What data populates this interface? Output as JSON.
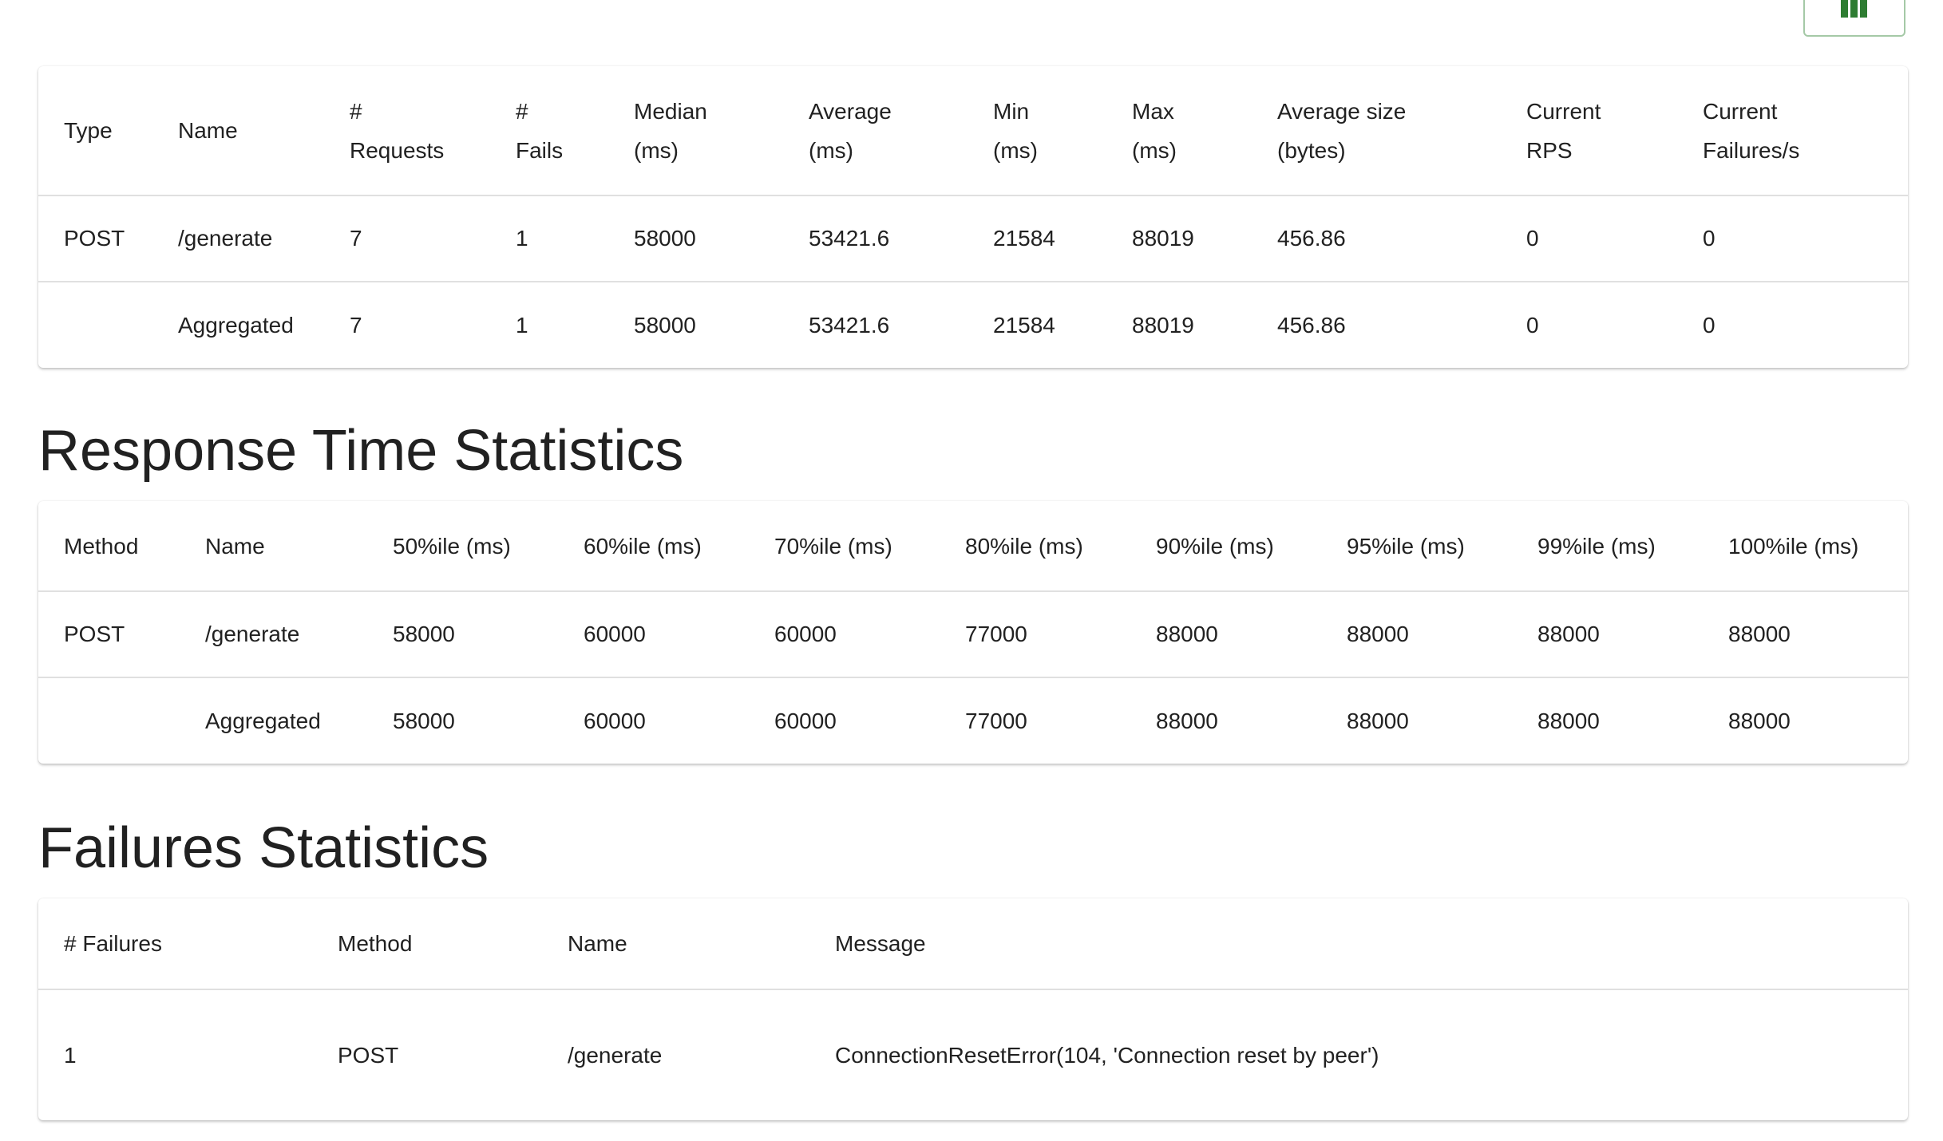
{
  "column_toggle": {
    "icon": "view-column-icon",
    "color": "#2e7d32"
  },
  "request_statistics": {
    "headers": [
      [
        "Type"
      ],
      [
        "Name"
      ],
      [
        "#",
        "Requests"
      ],
      [
        "#",
        "Fails"
      ],
      [
        "Median",
        "(ms)"
      ],
      [
        "Average",
        "(ms)"
      ],
      [
        "Min",
        "(ms)"
      ],
      [
        "Max",
        "(ms)"
      ],
      [
        "Average size",
        "(bytes)"
      ],
      [
        "Current",
        "RPS"
      ],
      [
        "Current",
        "Failures/s"
      ]
    ],
    "rows": [
      [
        "POST",
        "/generate",
        "7",
        "1",
        "58000",
        "53421.6",
        "21584",
        "88019",
        "456.86",
        "0",
        "0"
      ],
      [
        "",
        "Aggregated",
        "7",
        "1",
        "58000",
        "53421.6",
        "21584",
        "88019",
        "456.86",
        "0",
        "0"
      ]
    ]
  },
  "response_time_statistics": {
    "title": "Response Time Statistics",
    "headers": [
      "Method",
      "Name",
      "50%ile (ms)",
      "60%ile (ms)",
      "70%ile (ms)",
      "80%ile (ms)",
      "90%ile (ms)",
      "95%ile (ms)",
      "99%ile (ms)",
      "100%ile (ms)"
    ],
    "rows": [
      [
        "POST",
        "/generate",
        "58000",
        "60000",
        "60000",
        "77000",
        "88000",
        "88000",
        "88000",
        "88000"
      ],
      [
        "",
        "Aggregated",
        "58000",
        "60000",
        "60000",
        "77000",
        "88000",
        "88000",
        "88000",
        "88000"
      ]
    ]
  },
  "failures_statistics": {
    "title": "Failures Statistics",
    "headers": [
      "# Failures",
      "Method",
      "Name",
      "Message"
    ],
    "rows": [
      [
        "1",
        "POST",
        "/generate",
        "ConnectionResetError(104, 'Connection reset by peer')"
      ]
    ]
  }
}
